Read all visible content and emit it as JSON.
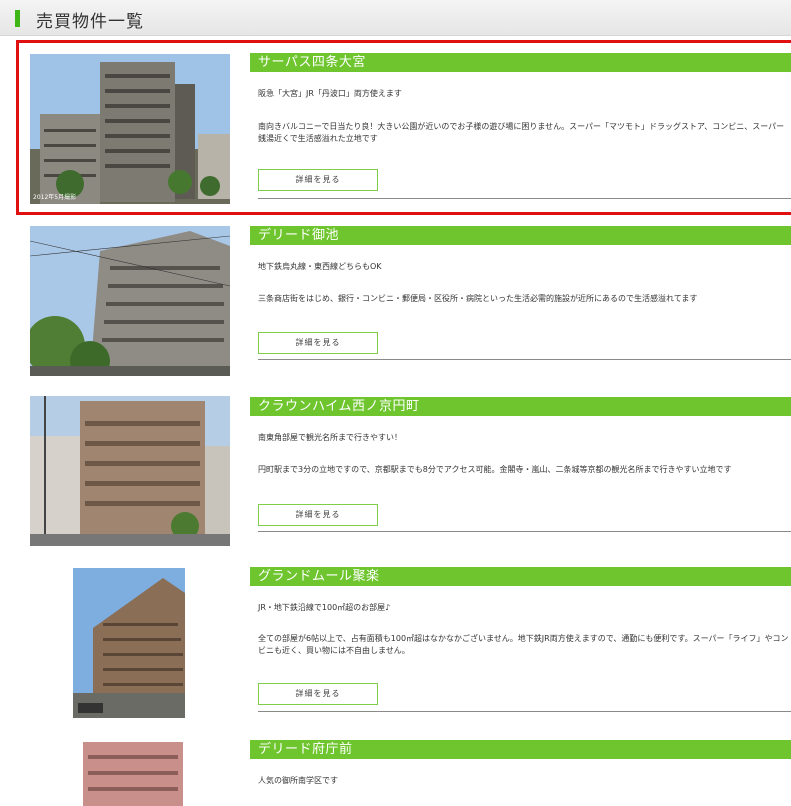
{
  "page": {
    "title": "売買物件一覧"
  },
  "listings": [
    {
      "name": "サーパス四条大宮",
      "summary": "阪急「大宮」JR「丹波口」両方使えます",
      "description": "南向きバルコニーで日当たり良！大きい公園が近いのでお子様の遊び場に困りません。スーパー「マツモト」ドラッグストア、コンビニ、スーパー銭湯近くで生活感溢れた立地です",
      "button_label": "詳細を見る",
      "photo_caption": "2012年5月撮影"
    },
    {
      "name": "デリード御池",
      "summary": "地下鉄烏丸線・東西線どちらもOK",
      "description": "三条商店街をはじめ、銀行・コンビニ・郵便局・区役所・病院といった生活必需的施設が近所にあるので生活感溢れてます",
      "button_label": "詳細を見る"
    },
    {
      "name": "クラウンハイム西ノ京円町",
      "summary": "南東角部屋で観光名所まで行きやすい！",
      "description": "円町駅まで3分の立地ですので、京都駅までも8分でアクセス可能。金閣寺・嵐山、二条城等京都の観光名所まで行きやすい立地です",
      "button_label": "詳細を見る"
    },
    {
      "name": "グランドムール聚楽",
      "summary": "JR・地下鉄沿線で100㎡超のお部屋♪",
      "description": "全ての部屋が6帖以上で、占有面積も100㎡超はなかなかございません。地下鉄JR両方使えますので、通勤にも便利です。スーパー「ライフ」やコンビニも近く、買い物には不自由しません。",
      "button_label": "詳細を見る"
    },
    {
      "name": "デリード府庁前",
      "summary": "人気の御所南学区です",
      "description": "",
      "button_label": ""
    }
  ]
}
